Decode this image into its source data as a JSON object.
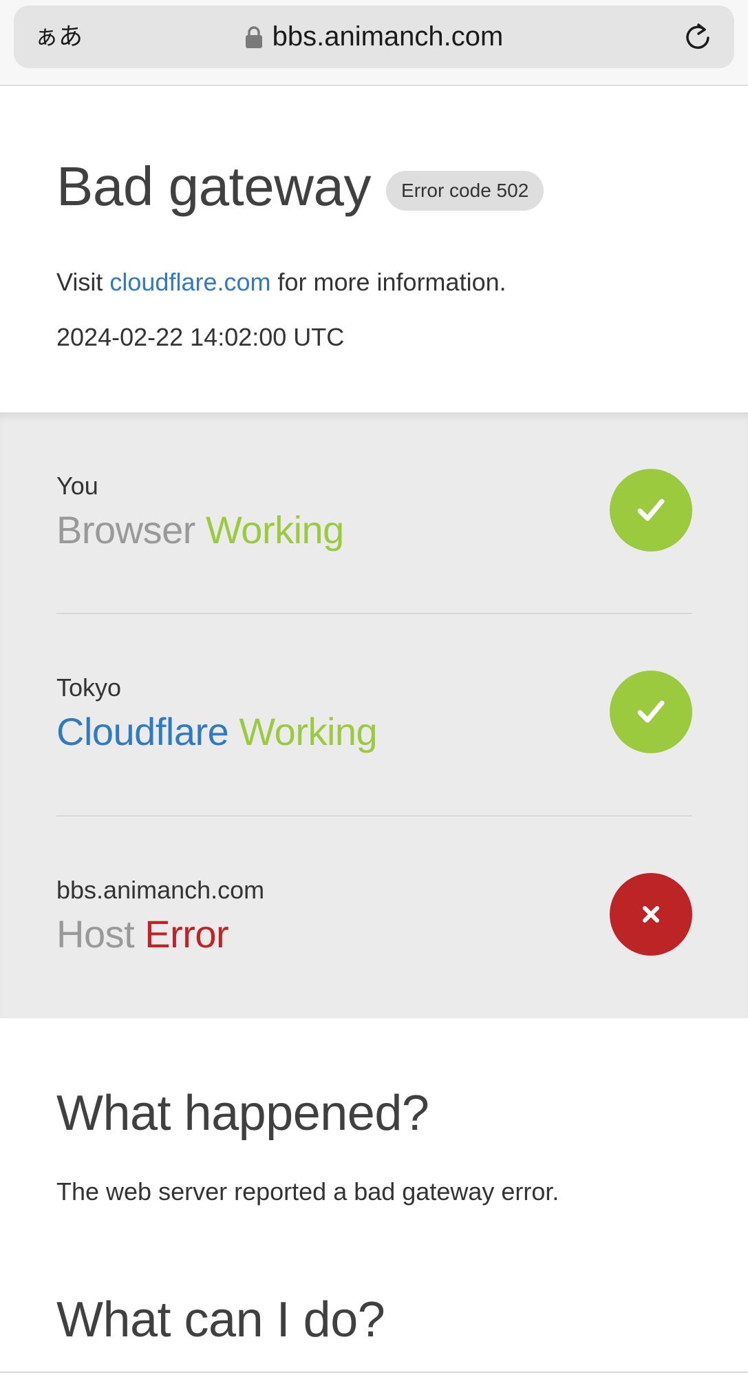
{
  "browser": {
    "text_size_label": "ぁあ",
    "url": "bbs.animanch.com"
  },
  "header": {
    "title": "Bad gateway",
    "error_badge": "Error code 502",
    "info_prefix": "Visit ",
    "info_link": "cloudflare.com",
    "info_suffix": " for more information.",
    "timestamp": "2024-02-22 14:02:00 UTC"
  },
  "status": [
    {
      "location": "You",
      "name": "Browser",
      "state": "Working",
      "icon": "check-icon",
      "ok": true
    },
    {
      "location": "Tokyo",
      "name": "Cloudflare",
      "state": "Working",
      "icon": "check-icon",
      "ok": true
    },
    {
      "location": "bbs.animanch.com",
      "name": "Host",
      "state": "Error",
      "icon": "close-icon",
      "ok": false
    }
  ],
  "what_happened": {
    "heading": "What happened?",
    "text": "The web server reported a bad gateway error."
  },
  "what_can_i_do": {
    "heading": "What can I do?"
  },
  "colors": {
    "working": "#9bca3e",
    "error": "#bd2426",
    "link": "#2f7bbf"
  }
}
